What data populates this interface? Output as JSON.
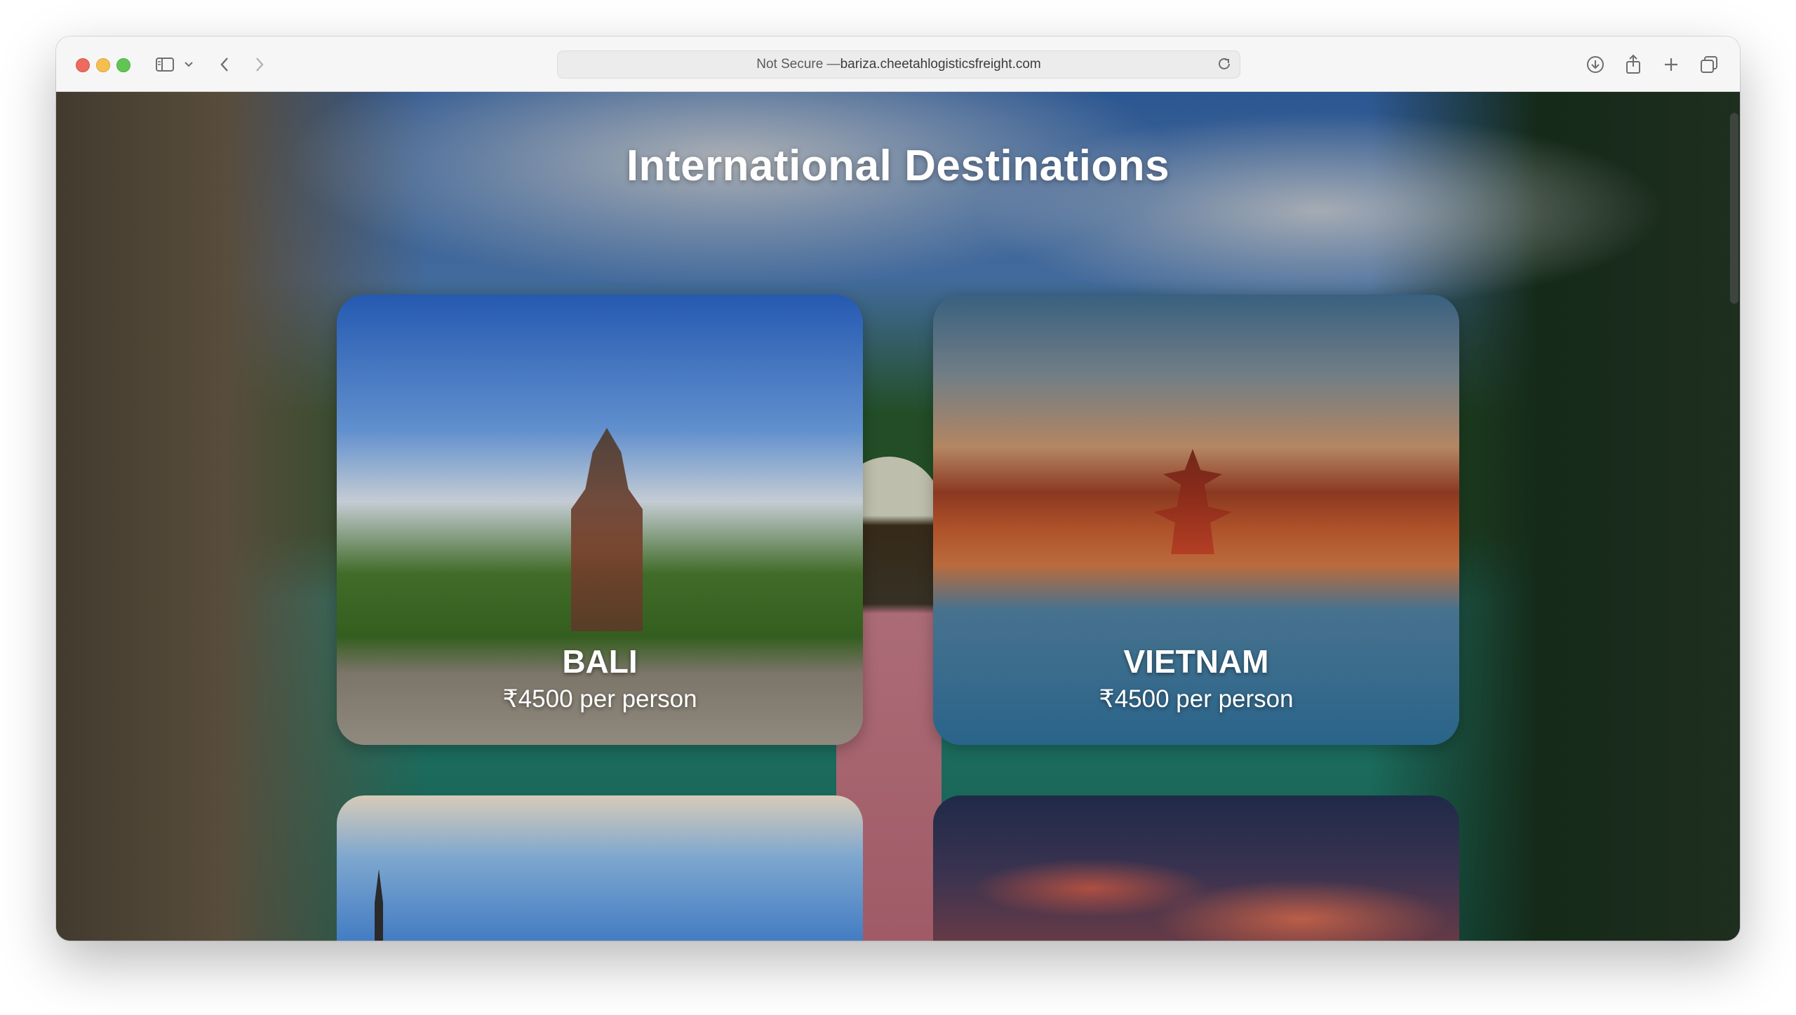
{
  "browser": {
    "address_prefix": "Not Secure — ",
    "address_domain": "bariza.cheetahlogisticsfreight.com"
  },
  "page": {
    "title": "International Destinations"
  },
  "destinations": [
    {
      "name": "BALI",
      "price": "₹4500 per person"
    },
    {
      "name": "VIETNAM",
      "price": "₹4500 per person"
    }
  ]
}
